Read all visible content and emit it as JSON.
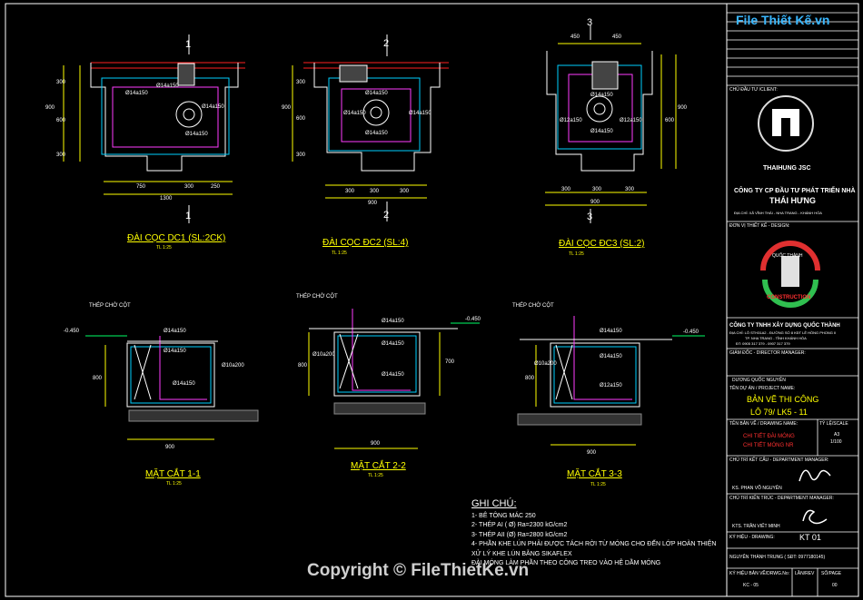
{
  "header": {
    "site_logo": "File Thiết Kế.vn"
  },
  "plans": [
    {
      "title": "ĐÀI CỌC DC1 (SL:2CK)",
      "scale": "TL 1:25",
      "section": "1",
      "dims": [
        "750",
        "300",
        "250",
        "1300",
        "300",
        "600",
        "900",
        "300"
      ],
      "rebar": [
        "Ø14a150",
        "Ø14a150",
        "Ø14a150",
        "Ø14a150"
      ]
    },
    {
      "title": "ĐÀI CỌC ĐC2 (SL:4)",
      "scale": "TL 1:25",
      "section": "2",
      "dims": [
        "300",
        "300",
        "300",
        "900",
        "300",
        "600",
        "900",
        "300"
      ],
      "rebar": [
        "Ø14a150",
        "Ø14a150",
        "Ø14a150",
        "Ø14a150"
      ]
    },
    {
      "title": "ĐÀI CỌC ĐC3 (SL:2)",
      "scale": "TL 1:25",
      "section": "3",
      "dims": [
        "450",
        "450",
        "300",
        "300",
        "300",
        "900",
        "600",
        "900"
      ],
      "rebar": [
        "Ø14a150",
        "Ø12a150",
        "Ø12a150",
        "Ø14a150"
      ]
    }
  ],
  "sections": [
    {
      "title": "MẶT CẮT 1-1",
      "scale": "TL 1:25",
      "steel_label": "THÉP CHỜ CỘT",
      "level": "-0.450",
      "dims": [
        "800",
        "900"
      ],
      "rebar": [
        "Ø14a150",
        "Ø14a150",
        "Ø14a150",
        "Ø10a200"
      ]
    },
    {
      "title": "MẶT CẮT 2-2",
      "scale": "TL 1:25",
      "steel_label": "THÉP CHỜ CỘT",
      "level": "-0.450",
      "dims": [
        "800",
        "700",
        "900"
      ],
      "rebar": [
        "Ø14a150",
        "Ø14a150",
        "Ø10a200",
        "Ø14a150"
      ]
    },
    {
      "title": "MẶT CẮT 3-3",
      "scale": "TL 1:25",
      "steel_label": "THÉP CHỜ CỘT",
      "level": "-0.450",
      "dims": [
        "800",
        "900"
      ],
      "rebar": [
        "Ø14a150",
        "Ø14a150",
        "Ø12a150",
        "Ø10a200"
      ]
    }
  ],
  "notes": {
    "heading": "GHI CHÚ:",
    "lines": [
      "1- BÊ TÔNG MÁC 250",
      "2- THÉP  AI ( Ø) Ra=2300 kG/cm2",
      "3- THÉP AII (Ø) Ra=2800 kG/cm2",
      "4- PHẦN KHE LÚN PHẢI ĐƯỢC TÁCH RỜI TỪ MÓNG CHO ĐẾN LỚP HOÀN THIỆN",
      "XỬ LÝ KHE LÚN BẰNG SIKAFLEX",
      "ĐÀI MÓNG LÀM PHẦN THEO CÔNG TREO VÀO HỆ DẦM MÓNG"
    ]
  },
  "copyright": "Copyright © FileThietKe.vn",
  "title_block": {
    "client_label": "CHỦ ĐẦU TƯ /CLIENT:",
    "logo1_text": "THAIHUNG JSC",
    "company1_line1": "CÔNG TY CP ĐẦU TƯ PHÁT TRIỂN NHÀ",
    "company1_line2": "THÁI HƯNG",
    "company1_addr": "ĐỊA CHỈ: XÃ VĨNH THÁI - NHA TRANG - KHÁNH HÒA",
    "design_label": "ĐƠN VỊ THIẾT KẾ - DESIGN:",
    "logo2_top": "QUỐC THÀNH",
    "logo2_bottom": "CONSTRUCTION",
    "company2": "CÔNG TY TNHH XÂY DỰNG QUỐC THÀNH",
    "company2_addr1": "ĐỊA CHỈ: LÔ STH31A2 - ĐƯỜNG SỐ 8 KĐT LÊ HỒNG PHONG II",
    "company2_addr2": "TP. NHA TRANG - TỈNH KHÁNH HÒA",
    "company2_tel": "ĐT: 0905 317 379 - 0907 317 379",
    "director_label": "GIÁM ĐỐC - DIRECTOR MANAGER:",
    "director_name": "DƯƠNG QUỐC NGUYÊN",
    "project_label": "TÊN DỰ ÁN / PROJECT NAME:",
    "project_name1": "BẢN VẼ THI CÔNG",
    "project_name2": "LÔ 79/ LK5 - 11",
    "drawing_label": "TÊN BẢN VẼ / DRAWING NAME:",
    "scale_label": "TỶ LỆ/SCALE",
    "drawing_name1": "CHI TIẾT ĐÀI MÓNG",
    "drawing_name2": "CHI TIẾT MÓNG NR",
    "paper": "A3",
    "scale": "1/100",
    "struct_label": "CHỦ TRÌ KẾT CẤU - DEPARTMENT MANAGER:",
    "struct_name": "KS. PHAN VÕ NGUYÊN",
    "arch_label": "CHỦ TRÌ KIẾN TRÚC - DEPARTMENT MANAGER:",
    "arch_name": "KTS. TRẦN VIẾT MINH",
    "drawing_no_label": "KÝ HIỆU - DRAWING:",
    "drawing_no": "KT 01",
    "designer": "NGUYỄN THÀNH TRUNG ( SĐT: 0977180145)",
    "code_label": "KÝ HIỆU BẢN VẼ/DRWG.No:",
    "rev_label": "LẦN/REV",
    "sheet_label": "SỐ/PAGE",
    "code": "KC - 05",
    "sheet": "00"
  },
  "colors": {
    "background": "#000000",
    "outline": "#ffffff",
    "pile": "#00d0ff",
    "rebar": "#ff3cff",
    "dimension": "#ffff00",
    "grid_red": "#ff2020",
    "title": "#ffff00"
  }
}
